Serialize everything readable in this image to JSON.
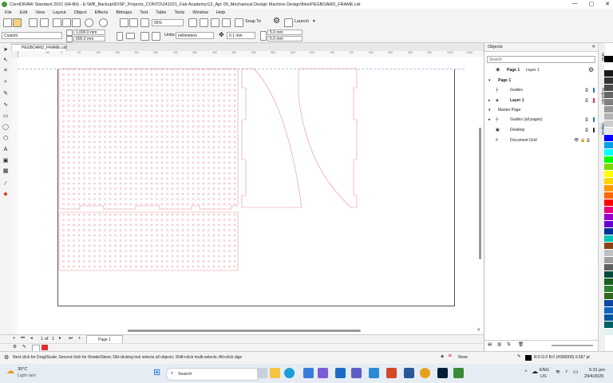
{
  "window": {
    "title": "CorelDRAW Standard 2021 (64-Bit) - E:\\WB_Backup\\ID\\SP_Projects_CONTD\\241021_Fab Academy\\12_Apr 09_Mechanical Design Machine Design\\files\\PEGBOARD_FRAME.cdr",
    "minimize": "—",
    "maximize": "▢",
    "close": "✕"
  },
  "menu": [
    "File",
    "Edit",
    "View",
    "Layout",
    "Object",
    "Effects",
    "Bitmaps",
    "Text",
    "Table",
    "Tools",
    "Window",
    "Help"
  ],
  "toolbar": {
    "zoom": "55%",
    "snap_label": "Snap To",
    "launch_label": "Launch"
  },
  "property_bar": {
    "page_preset": "Custom",
    "width": "1,000.0 mm",
    "height": "600.0 mm",
    "units_label": "Units:",
    "units_value": "millimeters",
    "nudge": "0.1 mm",
    "dup_x": "5.0 mm",
    "dup_y": "5.0 mm"
  },
  "document_tab": "PEGBOARD_FRAME.cdr",
  "ruler_ticks": [
    "-50",
    "0",
    "50",
    "100",
    "150",
    "200",
    "250",
    "300",
    "350",
    "400",
    "450",
    "500",
    "550",
    "600",
    "650",
    "700",
    "750",
    "800",
    "850",
    "900",
    "950",
    "1000",
    "1050"
  ],
  "objects_panel": {
    "title": "Objects",
    "search_placeholder": "Search",
    "page_selector": "Page 1",
    "layer_selector": "Layer 1",
    "rows": [
      {
        "label": "Page 1"
      },
      {
        "label": "Guides"
      },
      {
        "label": "Layer 1"
      },
      {
        "label": "Master Page"
      },
      {
        "label": "Guides (all pages)"
      },
      {
        "label": "Desktop"
      },
      {
        "label": "Document Grid"
      }
    ]
  },
  "side_tabs": [
    "Hints",
    "Properties",
    "Objects"
  ],
  "page_nav": {
    "current": "1",
    "of": "of",
    "total": "1",
    "page_tab": "Page 1"
  },
  "status": {
    "hint": "Next click for Drag/Scale; Second click for Rotate/Skew; Dbl-clicking tool selects all objects; Shift+click multi-selects; Alt+click digs",
    "fill": "None",
    "outline": "R:0 G:0 B:0 (#000000)  0.567 pt"
  },
  "taskbar": {
    "weather_temp": "30°C",
    "weather_desc": "Light rain",
    "search": "Search",
    "lang": "ENG",
    "region": "US",
    "time": "5:31 pm",
    "date": "29/4/2025"
  },
  "colors": {
    "outline_red": "#e8929a",
    "accent": "#2a6ebd"
  },
  "palette": [
    "#000000",
    "#ffffff",
    "#1a1a1a",
    "#333333",
    "#4d4d4d",
    "#666666",
    "#808080",
    "#999999",
    "#b3b3b3",
    "#cccccc",
    "#e6e6e6",
    "#0000ff",
    "#00a0e9",
    "#00ffff",
    "#00ff00",
    "#7fd700",
    "#ffff00",
    "#ffd700",
    "#ff9900",
    "#ff6600",
    "#ff0000",
    "#e6007e",
    "#9900cc",
    "#6600cc",
    "#003399",
    "#00c4b4",
    "#8b4513",
    "#c0c0c0",
    "#a0a0a0",
    "#606060",
    "#004d40",
    "#1b5e20",
    "#2e7d32",
    "#33691e",
    "#0d47a1",
    "#1565c0",
    "#01579b",
    "#006064",
    "#e0f2f1"
  ]
}
